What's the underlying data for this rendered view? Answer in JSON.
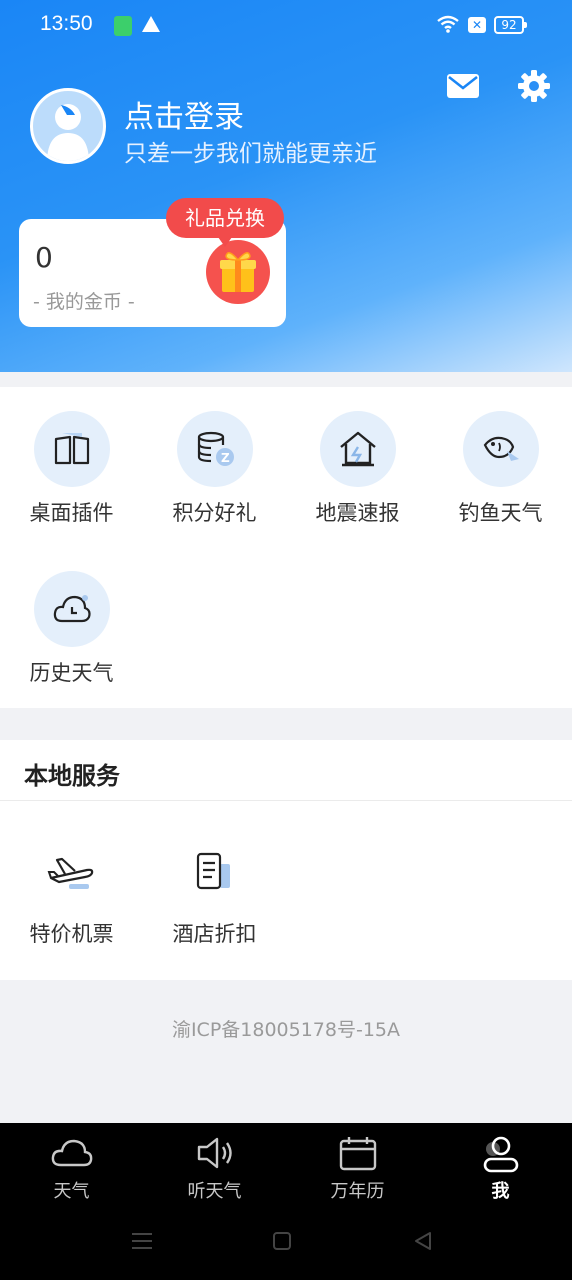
{
  "status_bar": {
    "time": "13:50",
    "battery": "92",
    "sim_icon": "sim-icon",
    "alert_icon": "warning-icon"
  },
  "header": {
    "login_title": "点击登录",
    "login_subtitle": "只差一步我们就能更亲近",
    "mail_icon": "mail-icon",
    "settings_icon": "gear-icon"
  },
  "coins": {
    "value": "0",
    "label": "- 我的金币 -",
    "gift_badge": "礼品兑换"
  },
  "features": [
    {
      "label": "桌面插件",
      "icon": "widget-book-icon"
    },
    {
      "label": "积分好礼",
      "icon": "coins-icon"
    },
    {
      "label": "地震速报",
      "icon": "earthquake-house-icon"
    },
    {
      "label": "钓鱼天气",
      "icon": "fish-icon"
    },
    {
      "label": "历史天气",
      "icon": "cloud-clock-icon"
    }
  ],
  "local_services": {
    "title": "本地服务",
    "items": [
      {
        "label": "特价机票",
        "icon": "airplane-icon"
      },
      {
        "label": "酒店折扣",
        "icon": "document-icon"
      }
    ]
  },
  "footer": {
    "icp": "渝ICP备18005178号-15A"
  },
  "tabs": [
    {
      "label": "天气",
      "icon": "cloud-icon"
    },
    {
      "label": "听天气",
      "icon": "speaker-icon"
    },
    {
      "label": "万年历",
      "icon": "calendar-icon"
    },
    {
      "label": "我",
      "icon": "user-icon",
      "active": true
    }
  ],
  "colors": {
    "primary": "#1a86f6",
    "accent_red": "#f24b4b",
    "icon_bg": "#e4effb"
  }
}
